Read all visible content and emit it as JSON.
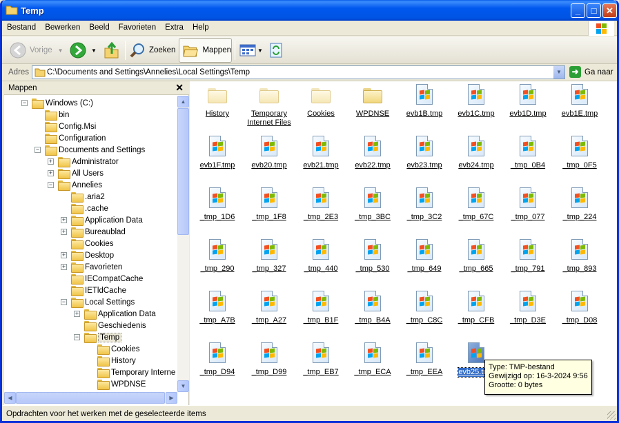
{
  "window": {
    "title": "Temp"
  },
  "menubar": {
    "items": [
      "Bestand",
      "Bewerken",
      "Beeld",
      "Favorieten",
      "Extra",
      "Help"
    ]
  },
  "toolbar": {
    "back_label": "Vorige",
    "search_label": "Zoeken",
    "folders_label": "Mappen"
  },
  "address": {
    "label": "Adres",
    "value": "C:\\Documents and Settings\\Annelies\\Local Settings\\Temp",
    "go_label": "Ga naar"
  },
  "folder_pane": {
    "title": "Mappen",
    "items": [
      {
        "label": "Windows (C:)",
        "expander": "−"
      },
      {
        "label": "bin",
        "expander": ""
      },
      {
        "label": "Config.Msi",
        "expander": ""
      },
      {
        "label": "Configuration",
        "expander": ""
      },
      {
        "label": "Documents and Settings",
        "expander": "−"
      },
      {
        "label": "Administrator",
        "expander": "+"
      },
      {
        "label": "All Users",
        "expander": "+"
      },
      {
        "label": "Annelies",
        "expander": "−"
      },
      {
        "label": ".aria2",
        "expander": ""
      },
      {
        "label": ".cache",
        "expander": ""
      },
      {
        "label": "Application Data",
        "expander": "+"
      },
      {
        "label": "Bureaublad",
        "expander": "+"
      },
      {
        "label": "Cookies",
        "expander": ""
      },
      {
        "label": "Desktop",
        "expander": "+"
      },
      {
        "label": "Favorieten",
        "expander": "+"
      },
      {
        "label": "IECompatCache",
        "expander": ""
      },
      {
        "label": "IETldCache",
        "expander": ""
      },
      {
        "label": "Local Settings",
        "expander": "−"
      },
      {
        "label": "Application Data",
        "expander": "+"
      },
      {
        "label": "Geschiedenis",
        "expander": ""
      },
      {
        "label": "Temp",
        "expander": "−"
      },
      {
        "label": "Cookies",
        "expander": ""
      },
      {
        "label": "History",
        "expander": ""
      },
      {
        "label": "Temporary Interne",
        "expander": ""
      },
      {
        "label": "WPDNSE",
        "expander": ""
      }
    ]
  },
  "files": [
    {
      "name": "History",
      "kind": "folder-faded"
    },
    {
      "name": "Temporary Internet Files",
      "kind": "folder-faded"
    },
    {
      "name": "Cookies",
      "kind": "folder-faded"
    },
    {
      "name": "WPDNSE",
      "kind": "folder"
    },
    {
      "name": "evb1B.tmp",
      "kind": "tmp"
    },
    {
      "name": "evb1C.tmp",
      "kind": "tmp"
    },
    {
      "name": "evb1D.tmp",
      "kind": "tmp"
    },
    {
      "name": "evb1E.tmp",
      "kind": "tmp"
    },
    {
      "name": "evb1F.tmp",
      "kind": "tmp"
    },
    {
      "name": "evb20.tmp",
      "kind": "tmp"
    },
    {
      "name": "evb21.tmp",
      "kind": "tmp"
    },
    {
      "name": "evb22.tmp",
      "kind": "tmp"
    },
    {
      "name": "evb23.tmp",
      "kind": "tmp"
    },
    {
      "name": "evb24.tmp",
      "kind": "tmp"
    },
    {
      "name": "_tmp_0B4",
      "kind": "tmp"
    },
    {
      "name": "_tmp_0F5",
      "kind": "tmp"
    },
    {
      "name": "_tmp_1D6",
      "kind": "tmp"
    },
    {
      "name": "_tmp_1F8",
      "kind": "tmp"
    },
    {
      "name": "_tmp_2E3",
      "kind": "tmp"
    },
    {
      "name": "_tmp_3BC",
      "kind": "tmp"
    },
    {
      "name": "_tmp_3C2",
      "kind": "tmp"
    },
    {
      "name": "_tmp_67C",
      "kind": "tmp"
    },
    {
      "name": "_tmp_077",
      "kind": "tmp"
    },
    {
      "name": "_tmp_224",
      "kind": "tmp"
    },
    {
      "name": "_tmp_290",
      "kind": "tmp"
    },
    {
      "name": "_tmp_327",
      "kind": "tmp"
    },
    {
      "name": "_tmp_440",
      "kind": "tmp"
    },
    {
      "name": "_tmp_530",
      "kind": "tmp"
    },
    {
      "name": "_tmp_649",
      "kind": "tmp"
    },
    {
      "name": "_tmp_665",
      "kind": "tmp"
    },
    {
      "name": "_tmp_791",
      "kind": "tmp"
    },
    {
      "name": "_tmp_893",
      "kind": "tmp"
    },
    {
      "name": "_tmp_A7B",
      "kind": "tmp"
    },
    {
      "name": "_tmp_A27",
      "kind": "tmp"
    },
    {
      "name": "_tmp_B1F",
      "kind": "tmp"
    },
    {
      "name": "_tmp_B4A",
      "kind": "tmp"
    },
    {
      "name": "_tmp_C8C",
      "kind": "tmp"
    },
    {
      "name": "_tmp_CFB",
      "kind": "tmp"
    },
    {
      "name": "_tmp_D3E",
      "kind": "tmp"
    },
    {
      "name": "_tmp_D08",
      "kind": "tmp"
    },
    {
      "name": "_tmp_D94",
      "kind": "tmp"
    },
    {
      "name": "_tmp_D99",
      "kind": "tmp"
    },
    {
      "name": "_tmp_EB7",
      "kind": "tmp"
    },
    {
      "name": "_tmp_ECA",
      "kind": "tmp"
    },
    {
      "name": "_tmp_EEA",
      "kind": "tmp"
    },
    {
      "name": "evb25.tmp",
      "kind": "tmp",
      "selected": true
    }
  ],
  "tooltip": {
    "type": "Type: TMP-bestand",
    "modified": "Gewijzigd op: 16-3-2024 9:56",
    "size": "Grootte: 0 bytes"
  },
  "status": {
    "text": "Opdrachten voor het werken met de geselecteerde items"
  },
  "colors": {
    "titlebar": "#0054e3",
    "selection": "#316ac5",
    "tooltip_bg": "#ffffe1"
  }
}
